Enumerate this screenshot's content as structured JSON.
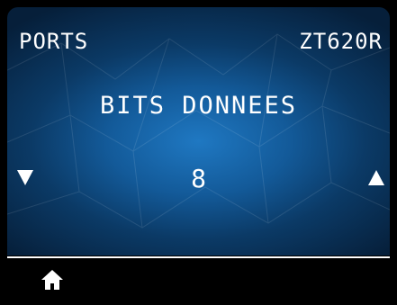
{
  "header": {
    "menu_title": "PORTS",
    "printer_model": "ZT620R"
  },
  "setting": {
    "name": "BITS DONNEES",
    "value": "8"
  },
  "icons": {
    "decrease": "triangle-down-icon",
    "increase": "triangle-up-icon",
    "home": "home-icon"
  },
  "colors": {
    "panel_center": "#1f78c2",
    "panel_edge": "#061f3a",
    "text": "#ffffff",
    "footer": "#000000"
  }
}
